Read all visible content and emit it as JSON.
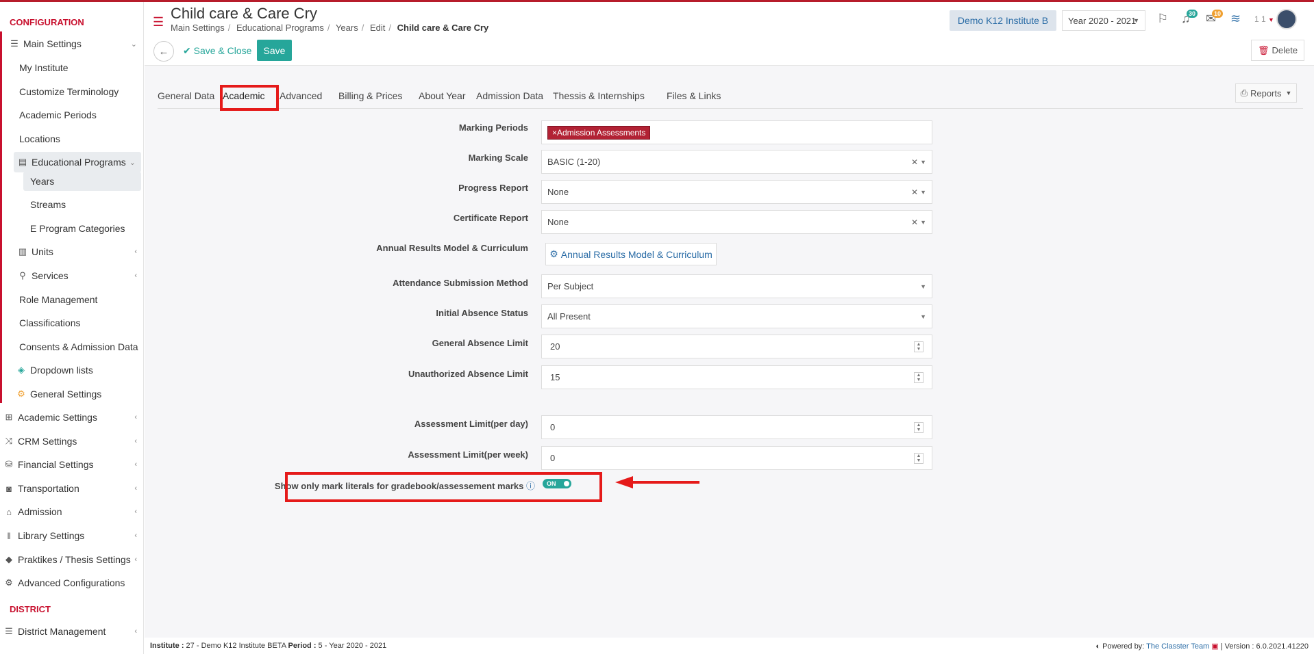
{
  "sidebar": {
    "config_label": "CONFIGURATION",
    "district_label": "DISTRICT",
    "items": [
      {
        "label": "Main Settings"
      },
      {
        "label": "My Institute"
      },
      {
        "label": "Customize Terminology"
      },
      {
        "label": "Academic Periods"
      },
      {
        "label": "Locations"
      },
      {
        "label": "Educational Programs"
      },
      {
        "label": "Years"
      },
      {
        "label": "Streams"
      },
      {
        "label": "E Program Categories"
      },
      {
        "label": "Units"
      },
      {
        "label": "Services"
      },
      {
        "label": "Role Management"
      },
      {
        "label": "Classifications"
      },
      {
        "label": "Consents & Admission Data"
      },
      {
        "label": "Dropdown lists"
      },
      {
        "label": "General Settings"
      },
      {
        "label": "Academic Settings"
      },
      {
        "label": "CRM Settings"
      },
      {
        "label": "Financial Settings"
      },
      {
        "label": "Transportation"
      },
      {
        "label": "Admission"
      },
      {
        "label": "Library Settings"
      },
      {
        "label": "Praktikes / Thesis Settings"
      },
      {
        "label": "Advanced Configurations"
      },
      {
        "label": "District Management"
      }
    ]
  },
  "header": {
    "title": "Child care & Care Cry",
    "breadcrumb": [
      "Main Settings",
      "Educational Programs",
      "Years",
      "Edit",
      "Child care & Care Cry"
    ],
    "institute": "Demo K12 Institute B",
    "year": "Year 2020 - 2021",
    "notif_count": "30",
    "mail_count": "10",
    "user_label": "1 1"
  },
  "toolbar": {
    "save_close": "Save & Close",
    "save": "Save",
    "delete": "Delete"
  },
  "tabs": [
    "General Data",
    "Academic",
    "Advanced",
    "Billing & Prices",
    "About Year",
    "Admission Data",
    "Thessis & Internships",
    "Files & Links"
  ],
  "reports_label": "Reports",
  "form": {
    "marking_periods": {
      "label": "Marking Periods",
      "tag": "×Admission Assessments"
    },
    "marking_scale": {
      "label": "Marking Scale",
      "value": "BASIC (1-20)"
    },
    "progress_report": {
      "label": "Progress Report",
      "value": "None"
    },
    "certificate_report": {
      "label": "Certificate Report",
      "value": "None"
    },
    "annual_results": {
      "label": "Annual Results Model & Curriculum",
      "button": "Annual Results Model & Curriculum"
    },
    "attendance_method": {
      "label": "Attendance Submission Method",
      "value": "Per Subject"
    },
    "initial_absence": {
      "label": "Initial Absence Status",
      "value": "All Present"
    },
    "general_absence": {
      "label": "General Absence Limit",
      "value": "20"
    },
    "unauth_absence": {
      "label": "Unauthorized Absence Limit",
      "value": "15"
    },
    "assess_day": {
      "label": "Assessment Limit(per day)",
      "value": "0"
    },
    "assess_week": {
      "label": "Assessment Limit(per week)",
      "value": "0"
    },
    "mark_literals": {
      "label": "Show only mark literals for gradebook/assessement marks",
      "toggle": "ON"
    }
  },
  "footer": {
    "institute_key": "Institute :",
    "institute_val": " 27 - Demo K12 Institute BETA ",
    "period_key": "Period :",
    "period_val": " 5 - Year 2020 - 2021",
    "powered": "Powered by:",
    "team": "The Classter Team",
    "version": "| Version : 6.0.2021.41220"
  },
  "colors": {
    "brand": "#c8102e",
    "accent": "#26a69a",
    "highlight": "#e51a1a"
  }
}
